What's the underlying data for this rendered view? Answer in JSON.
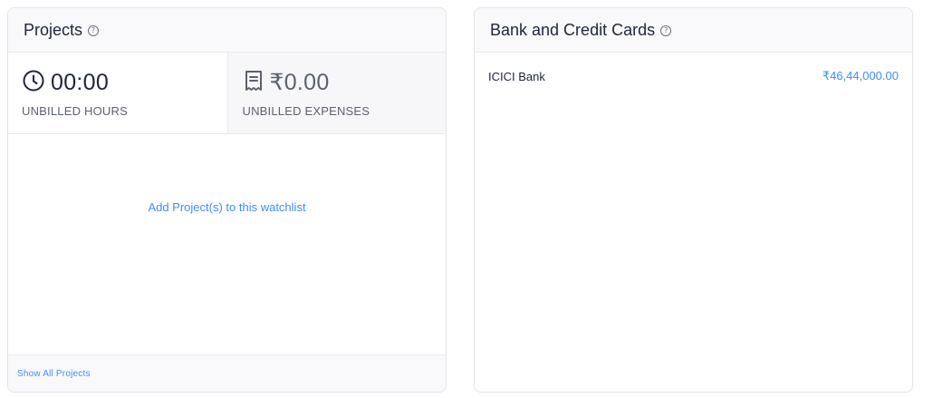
{
  "projects": {
    "title": "Projects",
    "help_glyph": "?",
    "unbilled_hours": {
      "value": "00:00",
      "label": "UNBILLED HOURS"
    },
    "unbilled_expenses": {
      "value": "₹0.00",
      "label": "UNBILLED EXPENSES"
    },
    "empty_action": "Add Project(s) to this watchlist",
    "footer_link": "Show All Projects"
  },
  "bank": {
    "title": "Bank and Credit Cards",
    "help_glyph": "?",
    "accounts": [
      {
        "name": "ICICI Bank",
        "amount": "₹46,44,000.00"
      }
    ]
  },
  "colors": {
    "accent": "#408dfb",
    "text": "#21263c",
    "muted": "#5c6170",
    "border": "#e3e4e8",
    "header_bg": "#f9f9fb"
  }
}
